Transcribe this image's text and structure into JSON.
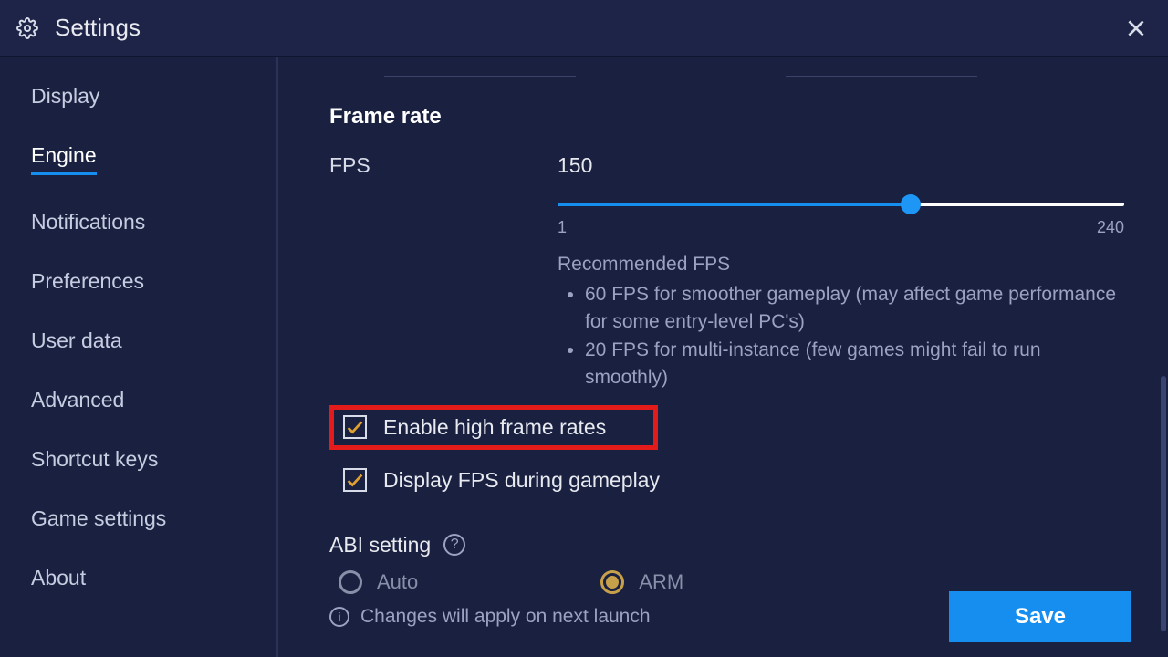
{
  "title": "Settings",
  "sidebar": {
    "items": [
      {
        "label": "Display"
      },
      {
        "label": "Engine",
        "active": true
      },
      {
        "label": "Notifications"
      },
      {
        "label": "Preferences"
      },
      {
        "label": "User data"
      },
      {
        "label": "Advanced"
      },
      {
        "label": "Shortcut keys"
      },
      {
        "label": "Game settings"
      },
      {
        "label": "About"
      }
    ]
  },
  "frame_rate": {
    "section_title": "Frame rate",
    "fps_label": "FPS",
    "fps_value": "150",
    "slider": {
      "min": "1",
      "max": "240",
      "value": 150,
      "min_n": 1,
      "max_n": 240
    },
    "recommended_title": "Recommended FPS",
    "recs": [
      "60 FPS for smoother gameplay (may affect game performance for some entry-level PC's)",
      "20 FPS for multi-instance (few games might fail to run smoothly)"
    ],
    "high_fps_label": "Enable high frame rates",
    "display_fps_label": "Display FPS during gameplay"
  },
  "abi": {
    "title": "ABI setting",
    "options": [
      {
        "label": "Auto",
        "selected": false
      },
      {
        "label": "ARM",
        "selected": true
      }
    ]
  },
  "footer": {
    "note": "Changes will apply on next launch",
    "save": "Save"
  }
}
